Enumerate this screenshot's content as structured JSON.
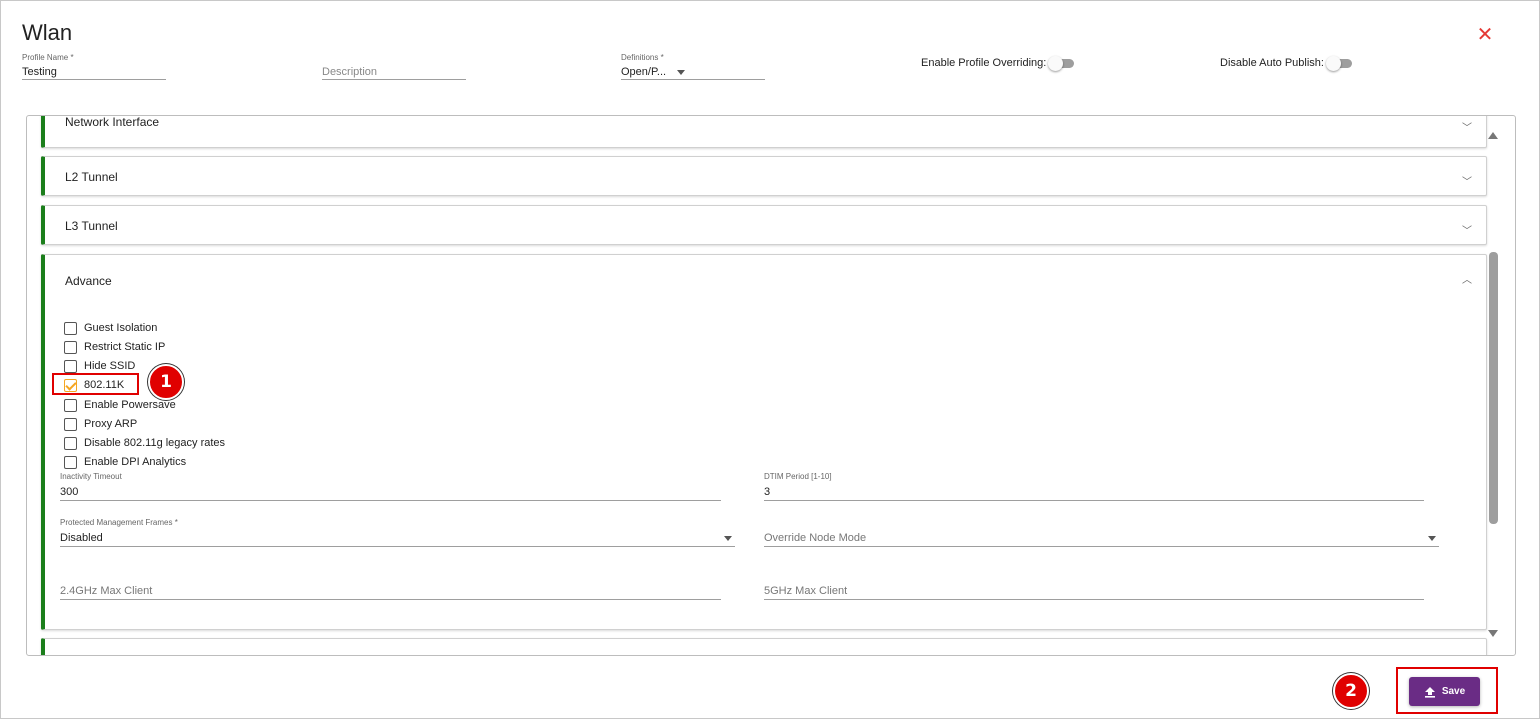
{
  "dialog": {
    "title": "Wlan",
    "close_icon": "close-icon"
  },
  "header_fields": {
    "profile_name": {
      "label": "Profile Name *",
      "value": "Testing"
    },
    "description": {
      "placeholder": "Description"
    },
    "definitions": {
      "label": "Definitions *",
      "value": "Open/P..."
    }
  },
  "toggles": {
    "enable_profile_overriding": {
      "label": "Enable Profile Overriding:",
      "on": false
    },
    "disable_auto_publish": {
      "label": "Disable Auto Publish:",
      "on": false
    }
  },
  "accordion": {
    "network_interface": "Network Interface",
    "l2_tunnel": "L2 Tunnel",
    "l3_tunnel": "L3 Tunnel",
    "advance": "Advance"
  },
  "advance": {
    "checkboxes": [
      {
        "label": "Guest Isolation",
        "checked": false
      },
      {
        "label": "Restrict Static IP",
        "checked": false
      },
      {
        "label": "Hide SSID",
        "checked": false
      },
      {
        "label": "802.11K",
        "checked": true
      },
      {
        "label": "Enable Powersave",
        "checked": false
      },
      {
        "label": "Proxy ARP",
        "checked": false
      },
      {
        "label": "Disable 802.11g legacy rates",
        "checked": false
      },
      {
        "label": "Enable DPI Analytics",
        "checked": false
      }
    ],
    "inactivity_timeout": {
      "label": "Inactivity Timeout",
      "value": "300"
    },
    "dtim_period": {
      "label": "DTIM Period [1-10]",
      "value": "3"
    },
    "protected_mgmt_frames": {
      "label": "Protected Management Frames *",
      "value": "Disabled"
    },
    "override_node_mode": {
      "placeholder": "Override Node Mode"
    },
    "max_client_24": {
      "placeholder": "2.4GHz Max Client"
    },
    "max_client_5": {
      "placeholder": "5GHz Max Client"
    }
  },
  "annotations": {
    "step1": "1",
    "step2": "2",
    "highlight_color": "#e00000"
  },
  "footer": {
    "save_label": "Save",
    "save_icon": "upload-icon",
    "button_color": "#6a2c85"
  },
  "colors": {
    "accordion_accent": "#1b7e1b",
    "checked": "#f5a623",
    "close": "#e53935"
  }
}
